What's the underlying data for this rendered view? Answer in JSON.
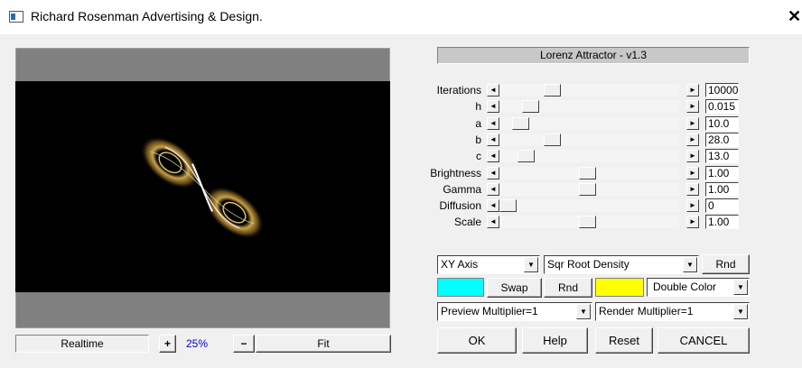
{
  "window": {
    "title": "Richard Rosenman Advertising & Design.",
    "close_glyph": "✕"
  },
  "version": "Lorenz Attractor - v1.3",
  "params": [
    {
      "label": "Iterations",
      "value": "10000",
      "level": 0.27
    },
    {
      "label": "h",
      "value": "0.015",
      "level": 0.14
    },
    {
      "label": "a",
      "value": "10.0",
      "level": 0.08
    },
    {
      "label": "b",
      "value": "28.0",
      "level": 0.27
    },
    {
      "label": "c",
      "value": "13.0",
      "level": 0.11
    },
    {
      "label": "Brightness",
      "value": "1.00",
      "level": 0.49
    },
    {
      "label": "Gamma",
      "value": "1.00",
      "level": 0.49
    },
    {
      "label": "Diffusion",
      "value": "0",
      "level": 0.0
    },
    {
      "label": "Scale",
      "value": "1.00",
      "level": 0.49
    }
  ],
  "axis_select": "XY Axis",
  "density_select": "Sqr Root Density",
  "rnd1": "Rnd",
  "color1": "#00ffff",
  "swap": "Swap",
  "rnd2": "Rnd",
  "color2": "#ffff00",
  "color_mode": "Double Color",
  "preview_mult": "Preview Multiplier=1",
  "render_mult": "Render Multiplier=1",
  "buttons": {
    "ok": "OK",
    "help": "Help",
    "reset": "Reset",
    "cancel": "CANCEL"
  },
  "preview_controls": {
    "realtime": "Realtime",
    "plus": "+",
    "zoom": "25%",
    "minus": "−",
    "fit": "Fit"
  },
  "zoom_color": "#0000cc"
}
